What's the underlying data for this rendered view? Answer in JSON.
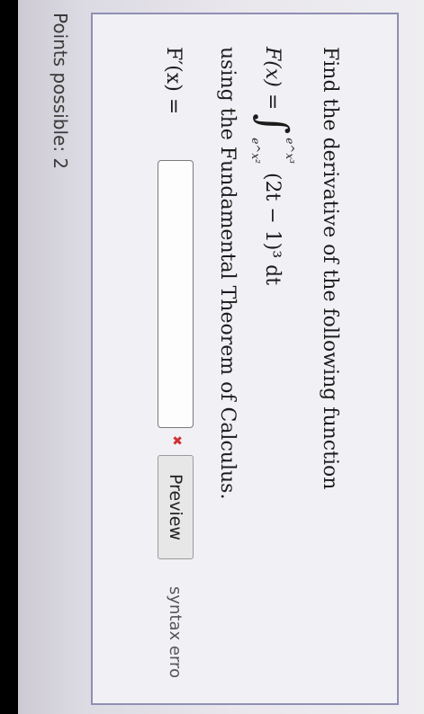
{
  "question": {
    "prompt": "Find the derivative of the following function",
    "function_lhs": "F(x) =",
    "integral_symbol": "∫",
    "upper_limit": "e^x³",
    "lower_limit": "e^x²",
    "integrand": "(2t − 1)³ dt",
    "method": "using the Fundamental Theorem of Calculus.",
    "answer_label": "F′(x) =",
    "answer_value": "",
    "status_symbol": "✖",
    "preview_label": "Preview",
    "syntax_message": "syntax erro"
  },
  "footer": {
    "points": "Points possible: 2"
  },
  "colors": {
    "card_border": "#8f8fb4",
    "status_error": "#d03030"
  }
}
